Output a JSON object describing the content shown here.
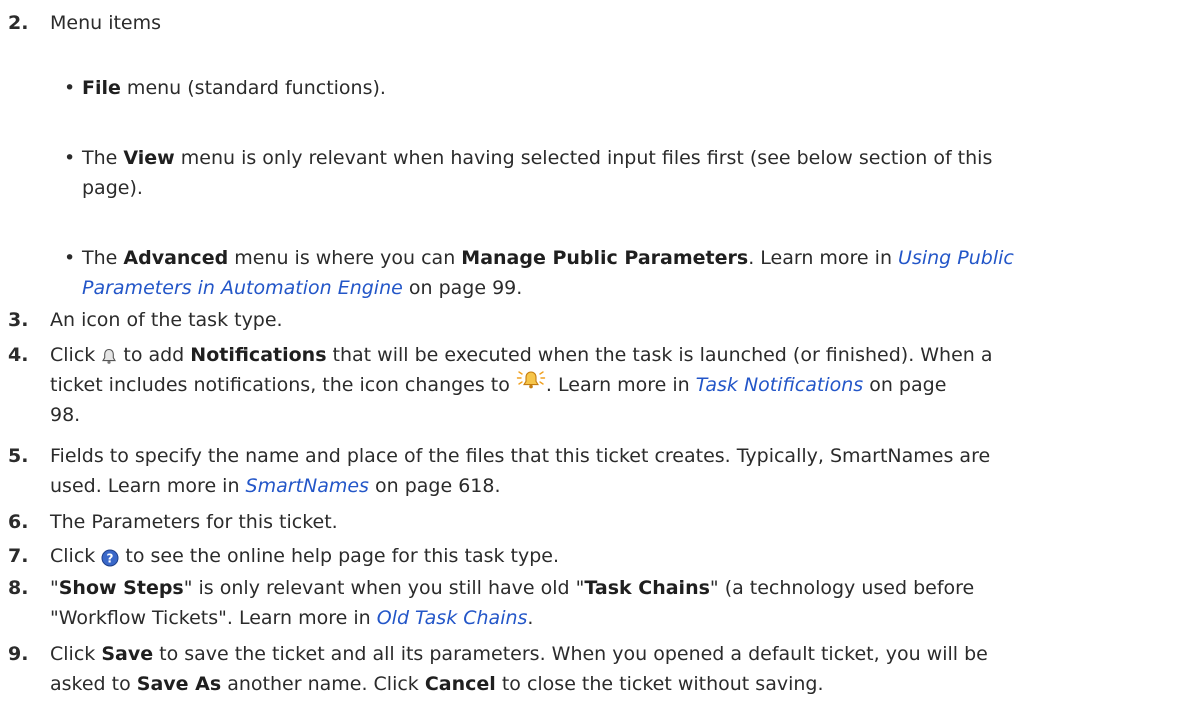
{
  "items": [
    {
      "num": "2.",
      "text": "Menu items"
    },
    {
      "num": "3.",
      "text": "An icon of the task type."
    },
    {
      "num": "4.",
      "parts": [
        "Click ",
        " to add ",
        "Notifications",
        " that will be executed when the task is launched (or finished). When a",
        "ticket includes notifications, the icon changes to ",
        ". Learn more in ",
        "Task Notifications",
        " on page",
        "98."
      ]
    },
    {
      "num": "5.",
      "parts": [
        "Fields to specify the name and place of the files that this ticket creates. Typically, SmartNames are",
        "used. Learn more in ",
        "SmartNames",
        " on page 618."
      ]
    },
    {
      "num": "6.",
      "text": "The Parameters for this ticket."
    },
    {
      "num": "7.",
      "parts": [
        "Click ",
        " to see the online help page for this task type."
      ]
    },
    {
      "num": "8.",
      "parts": [
        "\"",
        "Show Steps",
        "\" is only relevant when you still have old \"",
        "Task Chains",
        "\" (a technology used before",
        "\"Workflow Tickets\". Learn more in ",
        "Old Task Chains",
        "."
      ]
    },
    {
      "num": "9.",
      "parts": [
        "Click ",
        "Save",
        " to save the ticket and all its parameters. When you opened a default ticket, you will be",
        "asked to ",
        "Save As",
        " another name. Click ",
        "Cancel",
        " to close the ticket without saving."
      ]
    }
  ],
  "bullets": [
    {
      "parts": [
        "File",
        " menu (standard functions)."
      ]
    },
    {
      "parts": [
        "The ",
        "View",
        " menu is only relevant when having selected input files first (see below section of this",
        "page)."
      ]
    },
    {
      "parts": [
        "The ",
        "Advanced",
        " menu is where you can ",
        "Manage Public Parameters",
        ". Learn more in ",
        "Using Public",
        "Parameters in Automation Engine",
        " on page 99."
      ]
    }
  ],
  "icons": {
    "bell": "notification-bell-icon",
    "bell_active": "notification-bell-active-icon",
    "help": "help-icon",
    "bullet": "bullet-dot"
  },
  "colors": {
    "link": "#2356c8",
    "text": "#2b2b2b",
    "icon_blue": "#3a68c9",
    "bell_orange": "#f0a020"
  }
}
